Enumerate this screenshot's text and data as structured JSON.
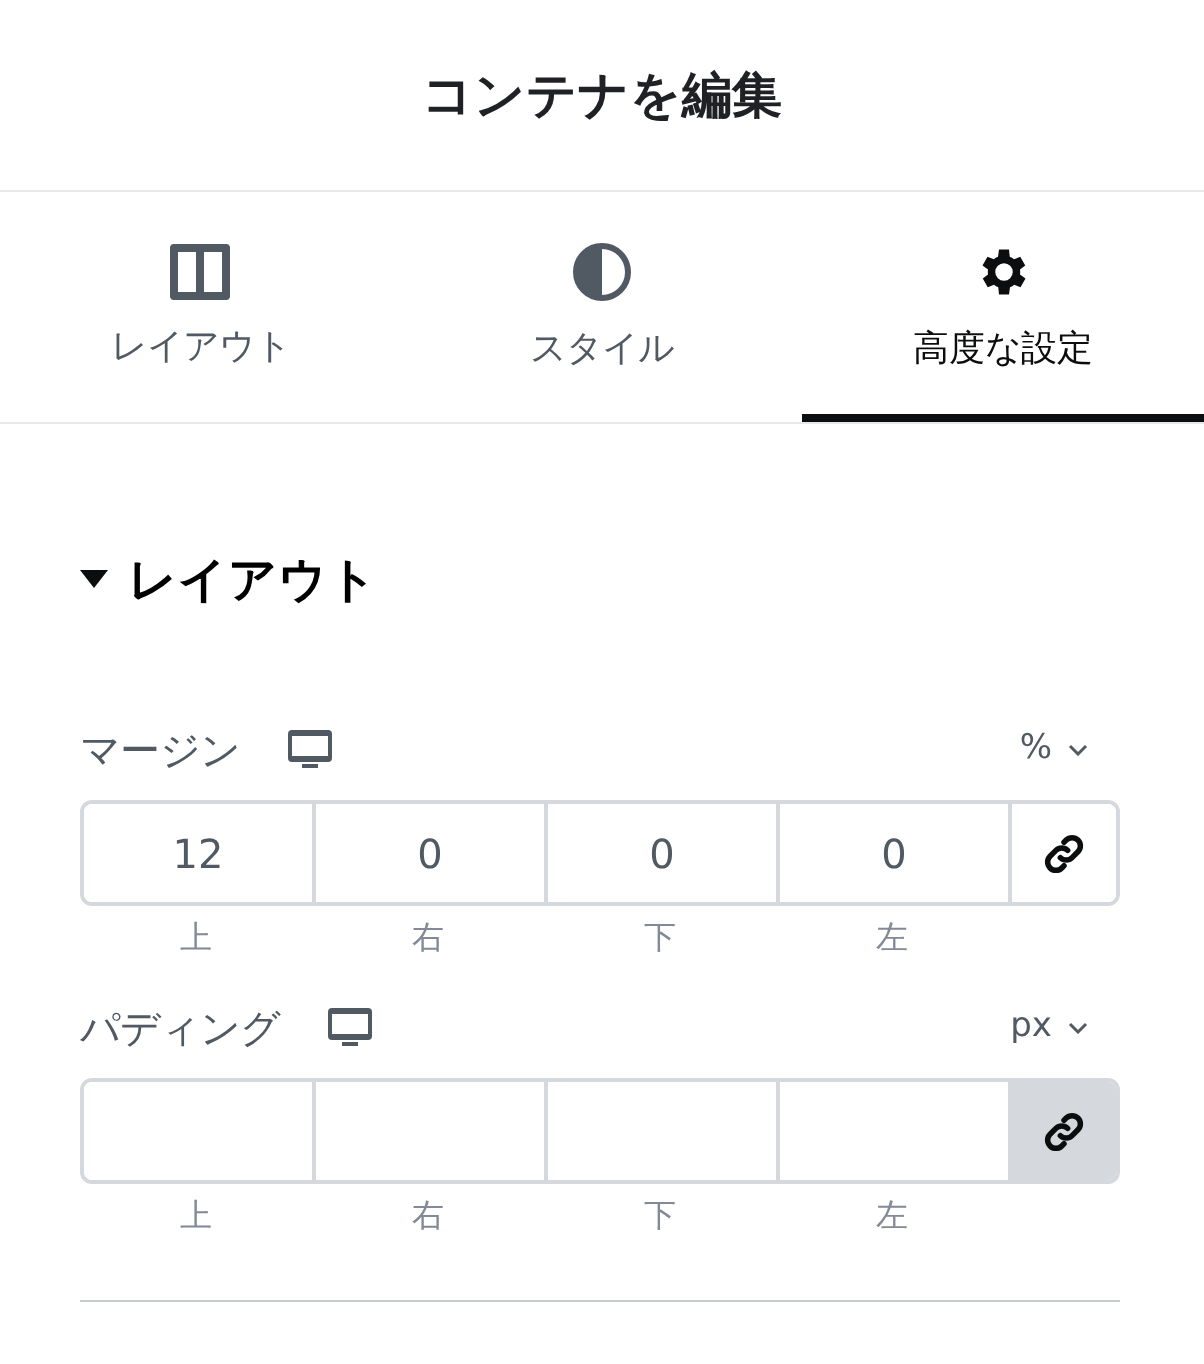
{
  "header": {
    "title": "コンテナを編集"
  },
  "tabs": [
    {
      "label": "レイアウト",
      "kind": "columns",
      "selected": false
    },
    {
      "label": "スタイル",
      "kind": "contrast",
      "selected": false
    },
    {
      "label": "高度な設定",
      "kind": "gear",
      "selected": true
    }
  ],
  "section": {
    "title": "レイアウト",
    "expanded": true
  },
  "controls": [
    {
      "label": "マージン",
      "unit": "%",
      "linked": false,
      "fields": [
        {
          "label": "上",
          "value": "12"
        },
        {
          "label": "右",
          "value": "0"
        },
        {
          "label": "下",
          "value": "0"
        },
        {
          "label": "左",
          "value": "0"
        }
      ]
    },
    {
      "label": "パディング",
      "unit": "px",
      "linked": true,
      "fields": [
        {
          "label": "上"
        },
        {
          "label": "右"
        },
        {
          "label": "下"
        },
        {
          "label": "左"
        }
      ]
    }
  ]
}
